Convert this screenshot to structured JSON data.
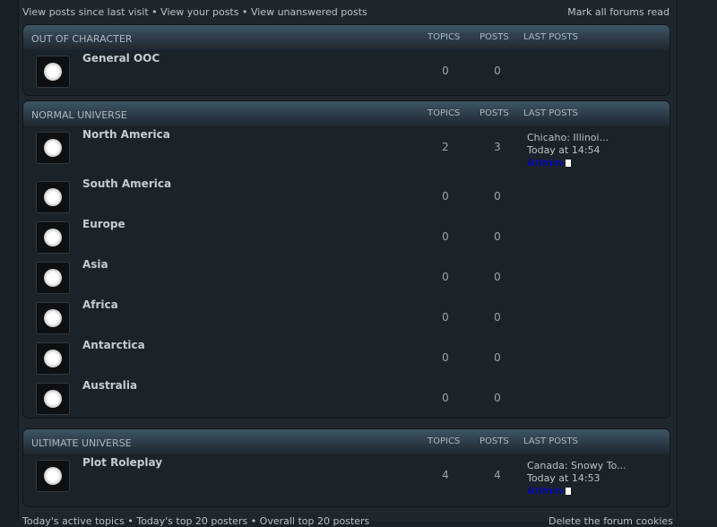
{
  "toplinks": [
    "View posts since last visit",
    "View your posts",
    "View unanswered posts"
  ],
  "separator": " • ",
  "mark_all": "Mark all forums read",
  "columns": {
    "topics": "TOPICS",
    "posts": "POSTS",
    "last": "LAST POSTS"
  },
  "categories": [
    {
      "title": "OUT OF CHARACTER",
      "forums": [
        {
          "name": "General OOC",
          "topics": "0",
          "posts": "0"
        }
      ]
    },
    {
      "title": "NORMAL UNIVERSE",
      "forums": [
        {
          "name": "North America",
          "topics": "2",
          "posts": "3",
          "last_title": "Chicaho: Illinoi...",
          "last_time": "Today at 14:54",
          "last_author": "Admin"
        },
        {
          "name": "South America",
          "topics": "0",
          "posts": "0"
        },
        {
          "name": "Europe",
          "topics": "0",
          "posts": "0"
        },
        {
          "name": "Asia",
          "topics": "0",
          "posts": "0"
        },
        {
          "name": "Africa",
          "topics": "0",
          "posts": "0"
        },
        {
          "name": "Antarctica",
          "topics": "0",
          "posts": "0"
        },
        {
          "name": "Australia",
          "topics": "0",
          "posts": "0"
        }
      ]
    },
    {
      "title": "ULTIMATE UNIVERSE",
      "forums": [
        {
          "name": "Plot Roleplay",
          "topics": "4",
          "posts": "4",
          "last_title": "Canada: Snowy To...",
          "last_time": "Today at 14:53",
          "last_author": "Admin"
        }
      ]
    }
  ],
  "footer": {
    "left": "Today's active topics • Today's top 20 posters • Overall top 20 posters",
    "right": "Delete the forum cookies"
  },
  "colors": {
    "author": "#0a0aa8",
    "header_top": "#3e5564",
    "panel_bg": "#1c2328"
  }
}
